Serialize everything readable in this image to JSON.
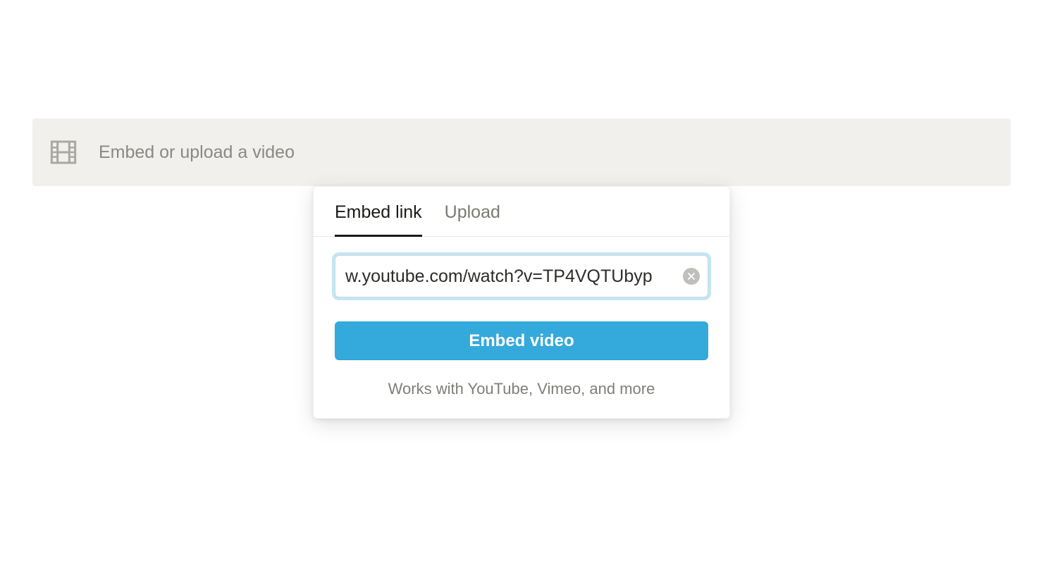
{
  "block": {
    "placeholder_text": "Embed or upload a video",
    "icon": "film-icon"
  },
  "popup": {
    "tabs": [
      {
        "label": "Embed link",
        "active": true
      },
      {
        "label": "Upload",
        "active": false
      }
    ],
    "url_input_value": "w.youtube.com/watch?v=TP4VQTUbyp",
    "clear_icon": "clear-icon",
    "embed_button_label": "Embed video",
    "hint_text": "Works with YouTube, Vimeo, and more"
  },
  "colors": {
    "accent": "#34aadc",
    "block_bg": "#f1f0ed",
    "text_muted": "#8a8883"
  }
}
